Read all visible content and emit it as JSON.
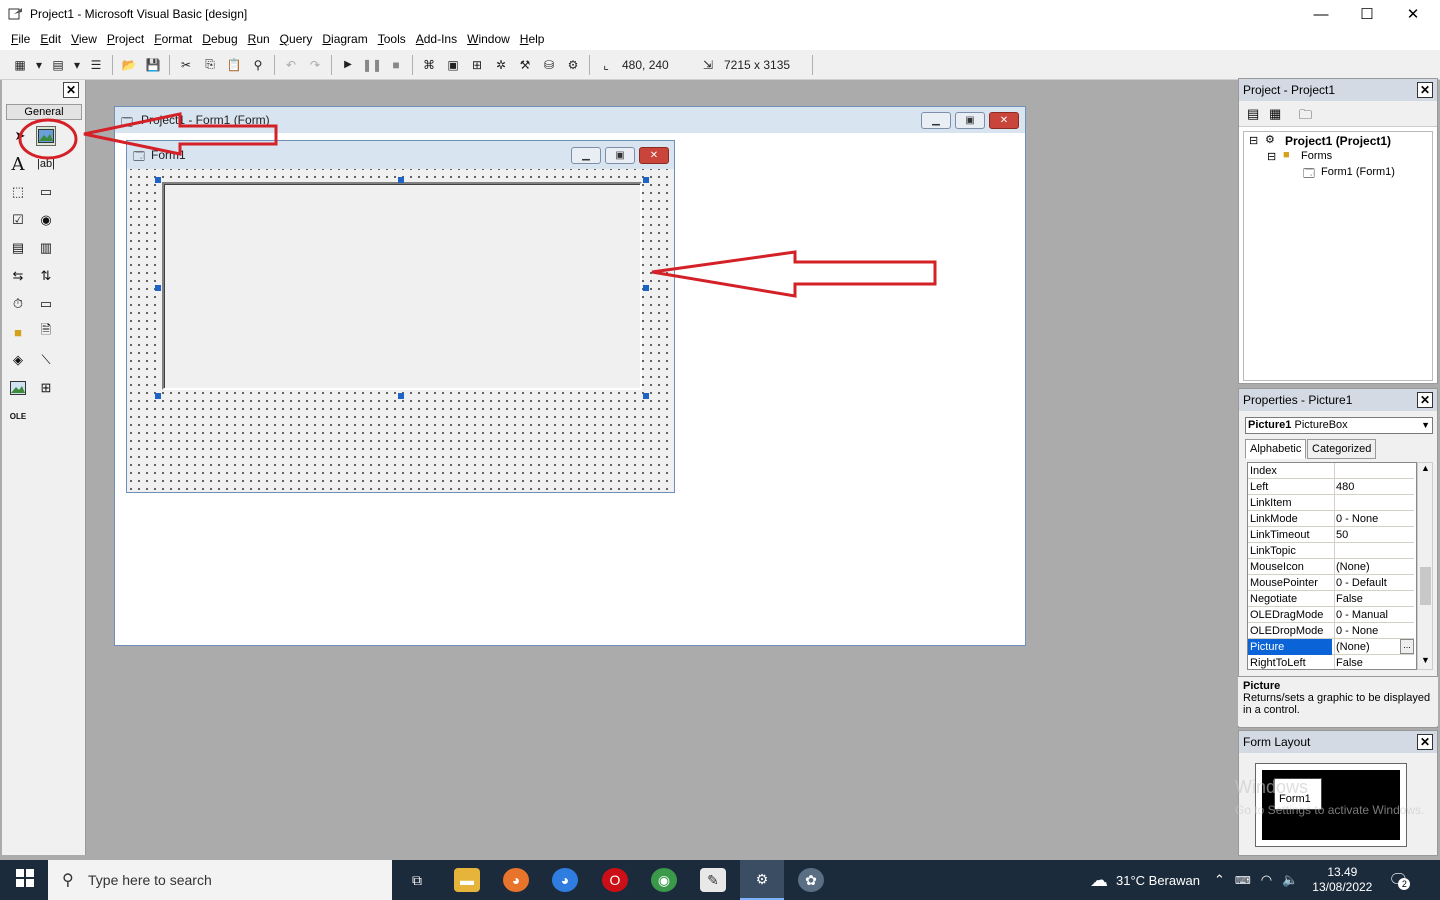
{
  "window": {
    "title": "Project1 - Microsoft Visual Basic [design]",
    "minimize": "—",
    "maximize": "☐",
    "close": "✕"
  },
  "menu": [
    "File",
    "Edit",
    "View",
    "Project",
    "Format",
    "Debug",
    "Run",
    "Query",
    "Diagram",
    "Tools",
    "Add-Ins",
    "Window",
    "Help"
  ],
  "toolbar": {
    "position": "480, 240",
    "size": "7215 x 3135"
  },
  "toolbox": {
    "tab": "General",
    "close": "✕"
  },
  "project_window": {
    "title": "Project1 - Form1 (Form)"
  },
  "form": {
    "title": "Form1"
  },
  "project_panel": {
    "title": "Project - Project1",
    "tree": [
      "Project1 (Project1)",
      "Forms",
      "Form1 (Form1)"
    ]
  },
  "properties_panel": {
    "title": "Properties - Picture1",
    "object_name": "Picture1",
    "object_type": "PictureBox",
    "tabs": [
      "Alphabetic",
      "Categorized"
    ],
    "rows": [
      {
        "name": "Index",
        "value": ""
      },
      {
        "name": "Left",
        "value": "480"
      },
      {
        "name": "LinkItem",
        "value": ""
      },
      {
        "name": "LinkMode",
        "value": "0 - None"
      },
      {
        "name": "LinkTimeout",
        "value": "50"
      },
      {
        "name": "LinkTopic",
        "value": ""
      },
      {
        "name": "MouseIcon",
        "value": "(None)"
      },
      {
        "name": "MousePointer",
        "value": "0 - Default"
      },
      {
        "name": "Negotiate",
        "value": "False"
      },
      {
        "name": "OLEDragMode",
        "value": "0 - Manual"
      },
      {
        "name": "OLEDropMode",
        "value": "0 - None"
      },
      {
        "name": "Picture",
        "value": "(None)"
      },
      {
        "name": "RightToLeft",
        "value": "False"
      }
    ],
    "selected_row": "Picture",
    "ellipsis": "...",
    "desc_title": "Picture",
    "desc_text": "Returns/sets a graphic to be displayed in a control."
  },
  "form_layout": {
    "title": "Form Layout",
    "form_label": "Form1",
    "watermark1": "Windows",
    "watermark2": "Go to Settings to activate Windows."
  },
  "taskbar": {
    "search_placeholder": "Type here to search",
    "weather": "31°C  Berawan",
    "time": "13.49",
    "date": "13/08/2022",
    "notifications": "2"
  },
  "colors": {
    "annotation": "#d42027",
    "selection": "#0a64d8"
  }
}
